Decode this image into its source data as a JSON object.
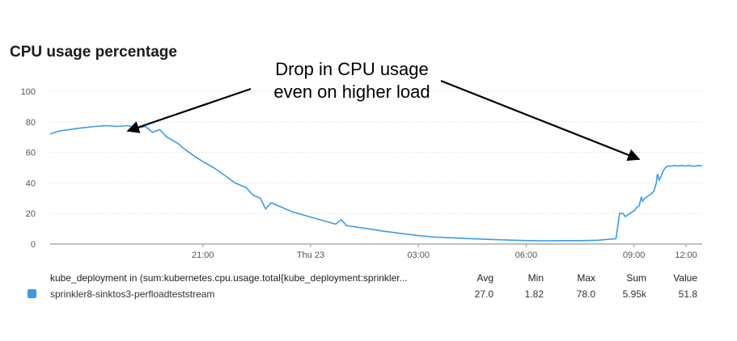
{
  "chart_data": {
    "type": "line",
    "title": "CPU usage percentage",
    "ylim": [
      0,
      100
    ],
    "yticks": [
      0,
      20,
      40,
      60,
      80,
      100
    ],
    "xticks": [
      "21:00",
      "Thu 23",
      "03:00",
      "06:00",
      "09:00",
      "12:00"
    ],
    "x_hours_range": [
      16.75,
      34.9
    ],
    "grid": true,
    "series": [
      {
        "name": "sprinkler8-sinktos3-perfloadteststream",
        "color": "#3a9be6",
        "points": [
          [
            16.75,
            72
          ],
          [
            17.0,
            74
          ],
          [
            17.3,
            75
          ],
          [
            17.6,
            76
          ],
          [
            18.0,
            77
          ],
          [
            18.3,
            77.5
          ],
          [
            18.6,
            77
          ],
          [
            18.9,
            77.5
          ],
          [
            19.2,
            76
          ],
          [
            19.4,
            77
          ],
          [
            19.6,
            73
          ],
          [
            19.8,
            75
          ],
          [
            20.0,
            70
          ],
          [
            20.3,
            66
          ],
          [
            20.5,
            62
          ],
          [
            20.8,
            57
          ],
          [
            21.0,
            54
          ],
          [
            21.3,
            50
          ],
          [
            21.6,
            45
          ],
          [
            21.9,
            40
          ],
          [
            22.2,
            37
          ],
          [
            22.4,
            32
          ],
          [
            22.6,
            30
          ],
          [
            22.75,
            23
          ],
          [
            22.9,
            27
          ],
          [
            23.2,
            24
          ],
          [
            23.5,
            21
          ],
          [
            23.8,
            19
          ],
          [
            24.1,
            17
          ],
          [
            24.4,
            15
          ],
          [
            24.7,
            13
          ],
          [
            24.85,
            16
          ],
          [
            25.0,
            12
          ],
          [
            25.3,
            11
          ],
          [
            25.6,
            10
          ],
          [
            26.0,
            8.5
          ],
          [
            26.5,
            7
          ],
          [
            27.0,
            5.5
          ],
          [
            27.5,
            4.5
          ],
          [
            28.0,
            4
          ],
          [
            28.5,
            3.5
          ],
          [
            29.0,
            3
          ],
          [
            29.5,
            2.6
          ],
          [
            30.0,
            2.3
          ],
          [
            30.5,
            2.1
          ],
          [
            31.0,
            2.2
          ],
          [
            31.5,
            2.2
          ],
          [
            32.0,
            2.5
          ],
          [
            32.5,
            3.5
          ],
          [
            33.0,
            5
          ],
          [
            33.3,
            6.5
          ],
          [
            33.6,
            9
          ],
          [
            33.8,
            11
          ],
          [
            34.0,
            13
          ],
          [
            34.2,
            15
          ],
          [
            34.4,
            18
          ],
          [
            34.6,
            19
          ],
          [
            34.75,
            20
          ]
        ],
        "points_after_midnight": [
          [
            0.0,
            20
          ],
          [
            0.3,
            20
          ],
          [
            0.5,
            18
          ],
          [
            0.7,
            19
          ],
          [
            0.9,
            20
          ],
          [
            1.1,
            21
          ],
          [
            1.3,
            22
          ],
          [
            1.5,
            24
          ],
          [
            1.7,
            25
          ],
          [
            1.9,
            31
          ],
          [
            2.0,
            28
          ],
          [
            2.2,
            30
          ],
          [
            2.4,
            31
          ],
          [
            2.6,
            32
          ],
          [
            2.8,
            33
          ],
          [
            3.0,
            35
          ],
          [
            3.2,
            40
          ],
          [
            3.3,
            46
          ],
          [
            3.45,
            42
          ],
          [
            3.6,
            44
          ],
          [
            3.8,
            48
          ],
          [
            4.0,
            50
          ],
          [
            4.2,
            51
          ],
          [
            4.5,
            51
          ],
          [
            4.8,
            51.5
          ],
          [
            5.1,
            51
          ],
          [
            5.4,
            51.5
          ],
          [
            5.7,
            51
          ],
          [
            6.0,
            51.5
          ],
          [
            6.3,
            51
          ],
          [
            6.6,
            51
          ],
          [
            6.9,
            51.5
          ],
          [
            7.2,
            51
          ]
        ]
      }
    ],
    "annotation": [
      "Drop in CPU usage",
      "even on higher load"
    ]
  },
  "legend": {
    "header": "kube_deployment in (sum:kubernetes.cpu.usage.total{kube_deployment:sprinkler...",
    "columns": [
      "Avg",
      "Min",
      "Max",
      "Sum",
      "Value"
    ],
    "rows": [
      {
        "name": "sprinkler8-sinktos3-perfloadteststream",
        "values": [
          "27.0",
          "1.82",
          "78.0",
          "5.95k",
          "51.8"
        ]
      }
    ]
  }
}
